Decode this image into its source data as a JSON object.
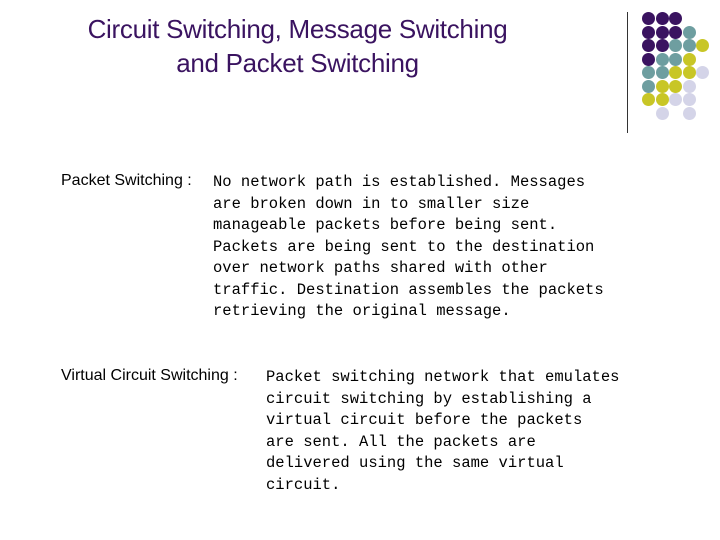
{
  "slide": {
    "title_line1": "Circuit Switching, Message Switching",
    "title_line2": "and Packet Switching",
    "decoration": {
      "icon": "dot-grid-icon",
      "colors": {
        "purple": "#3a1360",
        "teal": "#6e9ea0",
        "yellow": "#c8c626",
        "lavender": "#d4d4e8"
      },
      "rows": [
        [
          "purple",
          "purple",
          "purple",
          null,
          null
        ],
        [
          "purple",
          "purple",
          "purple",
          "teal",
          null
        ],
        [
          "purple",
          "purple",
          "teal",
          "teal",
          "yellow"
        ],
        [
          "purple",
          "teal",
          "teal",
          "yellow",
          null
        ],
        [
          "teal",
          "teal",
          "yellow",
          "yellow",
          "lavender"
        ],
        [
          "teal",
          "yellow",
          "yellow",
          "lavender",
          null
        ],
        [
          "yellow",
          "yellow",
          "lavender",
          "lavender",
          null
        ],
        [
          null,
          "lavender",
          null,
          "lavender",
          null
        ]
      ]
    },
    "entries": [
      {
        "term": "Packet Switching :",
        "lines": [
          "No network path is established. Messages",
          "are broken down in to smaller size",
          "manageable packets before being sent.",
          "Packets are being sent to the destination",
          "over network paths shared with other",
          "traffic. Destination assembles the packets",
          "retrieving the original message."
        ]
      },
      {
        "term": "Virtual Circuit Switching :",
        "lines": [
          "Packet switching network that emulates",
          "circuit switching by establishing a",
          "virtual circuit before the packets",
          "are sent. All the packets are",
          "delivered using the same virtual",
          "circuit."
        ]
      }
    ]
  }
}
